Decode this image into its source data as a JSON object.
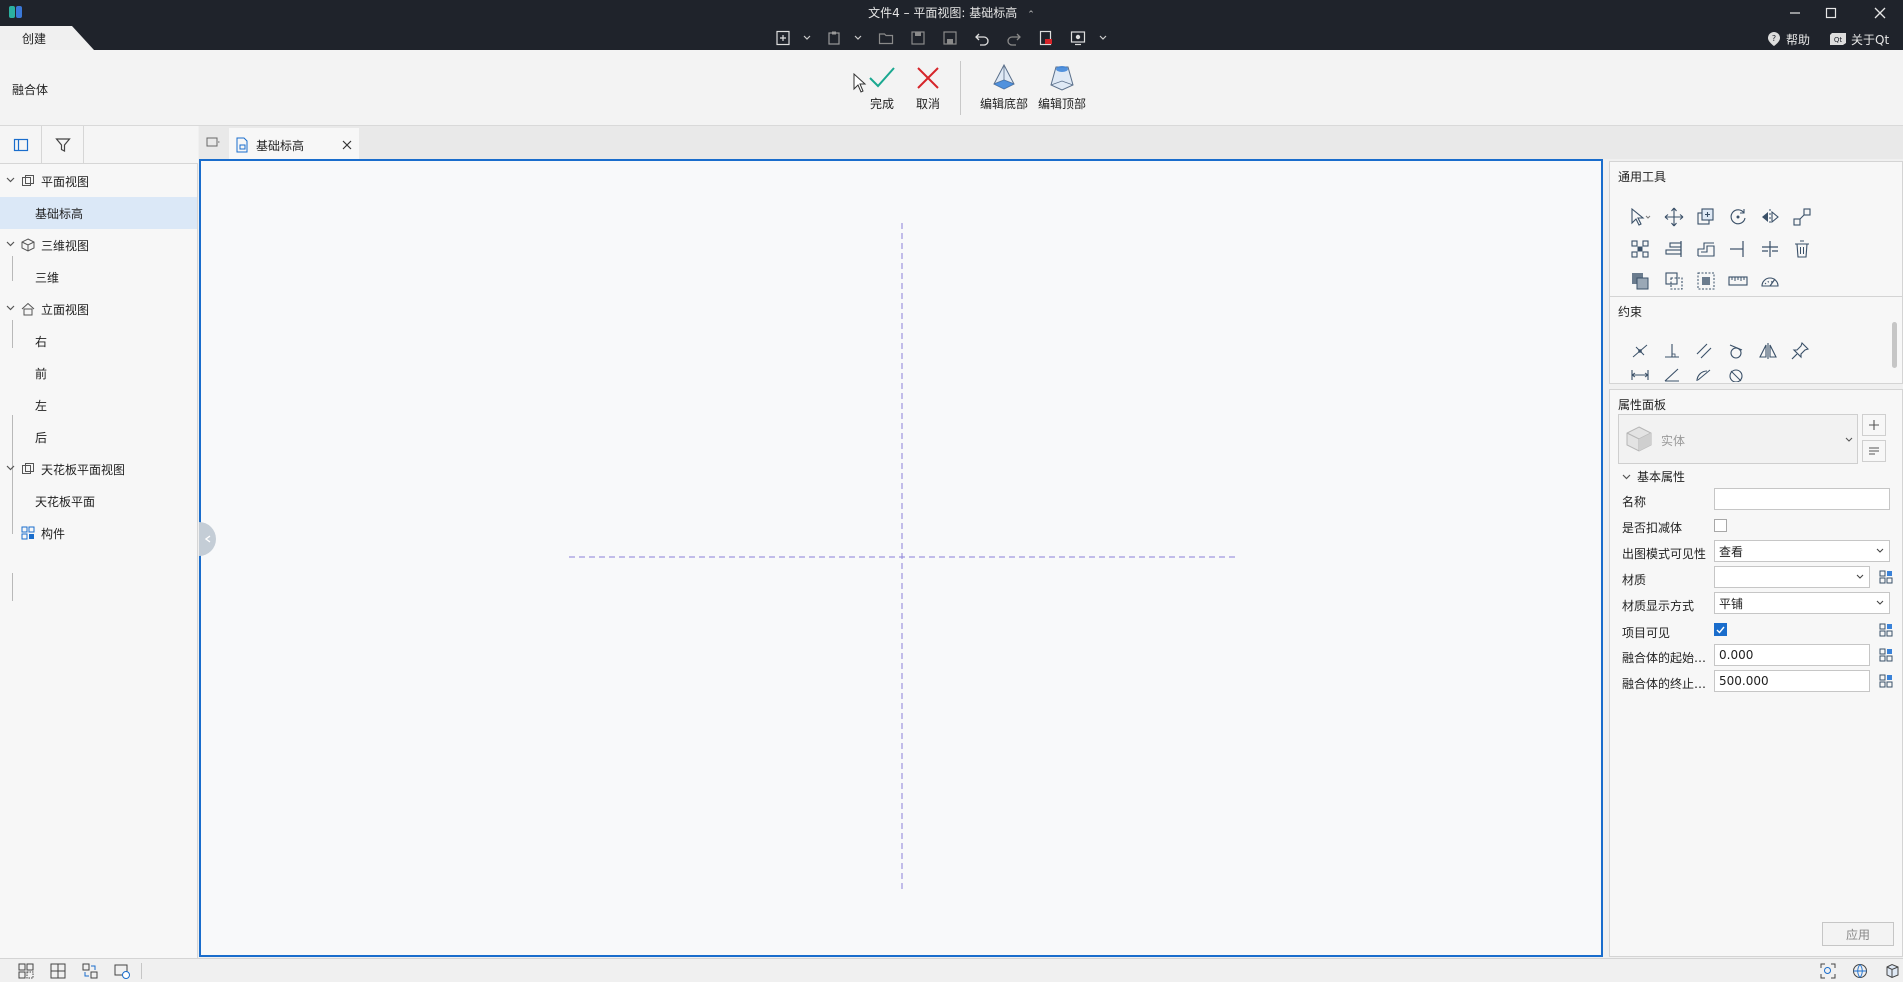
{
  "window": {
    "title": "文件4 – 平面视图: 基础标高",
    "title_chevron": "⌃"
  },
  "menu_tab": {
    "label": "创建"
  },
  "header_right": {
    "help_label": "帮助",
    "about_label": "关于Qt"
  },
  "ribbon": {
    "mode_label": "融合体",
    "finish_label": "完成",
    "cancel_label": "取消",
    "edit_bottom_label": "编辑底部",
    "edit_top_label": "编辑顶部"
  },
  "tree": {
    "items": [
      {
        "label": "平面视图"
      },
      {
        "label": "基础标高"
      },
      {
        "label": "三维视图"
      },
      {
        "label": "三维"
      },
      {
        "label": "立面视图"
      },
      {
        "label": "右"
      },
      {
        "label": "前"
      },
      {
        "label": "左"
      },
      {
        "label": "后"
      },
      {
        "label": "天花板平面视图"
      },
      {
        "label": "天花板平面"
      },
      {
        "label": "构件"
      }
    ]
  },
  "doc_tab": {
    "label": "基础标高"
  },
  "right_panel": {
    "general_tools_title": "通用工具",
    "constraints_title": "约束",
    "properties_title": "属性面板",
    "type_selector_value": "实体",
    "basic_props_title": "基本属性",
    "props": [
      {
        "label": "名称",
        "value": ""
      },
      {
        "label": "是否扣减体",
        "value": ""
      },
      {
        "label": "出图模式可见性",
        "value": "查看"
      },
      {
        "label": "材质",
        "value": ""
      },
      {
        "label": "材质显示方式",
        "value": "平铺"
      },
      {
        "label": "项目可见",
        "value": ""
      },
      {
        "label": "融合体的起始…",
        "value": "0.000"
      },
      {
        "label": "融合体的终止…",
        "value": "500.000"
      }
    ],
    "apply_label": "应用"
  },
  "colors": {
    "titlebar_bg": "#1f232b",
    "canvas_border": "#1a6dcc",
    "selection_bg": "#dbe8f7",
    "finish_green": "#1aa890",
    "cancel_red": "#d6252a",
    "ref_line": "#8a7fd8"
  }
}
